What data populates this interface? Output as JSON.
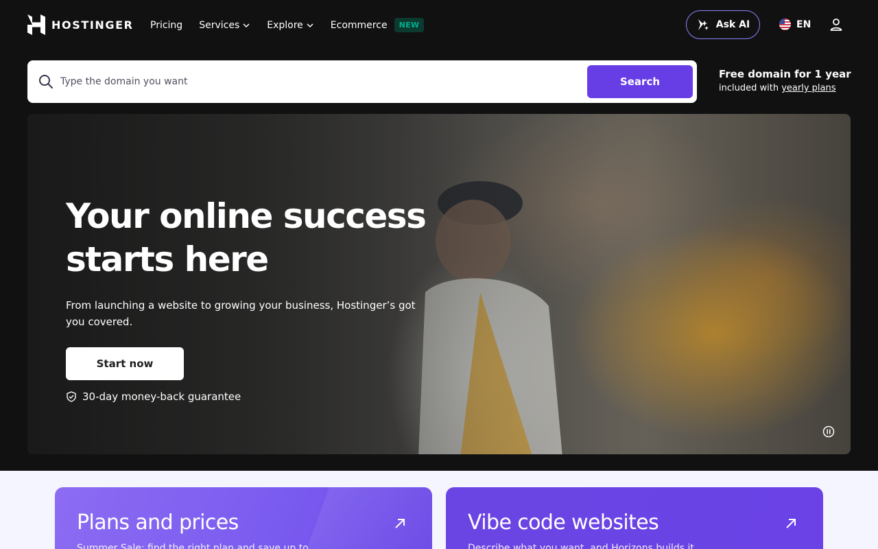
{
  "brand": {
    "name": "HOSTINGER"
  },
  "nav": {
    "items": [
      {
        "label": "Pricing",
        "has_dropdown": false
      },
      {
        "label": "Services",
        "has_dropdown": true
      },
      {
        "label": "Explore",
        "has_dropdown": true
      },
      {
        "label": "Ecommerce",
        "has_dropdown": false,
        "badge": "NEW"
      }
    ],
    "ask_ai_label": "Ask AI",
    "language": "EN",
    "icons": [
      "hostinger-logo-icon",
      "chevron-down-icon",
      "ai-sparkle-icon",
      "us-flag-icon",
      "user-icon"
    ]
  },
  "search": {
    "placeholder": "Type the domain you want",
    "value": "",
    "button_label": "Search"
  },
  "promo": {
    "title": "Free domain for 1 year",
    "subtitle_prefix": "included with ",
    "subtitle_link": "yearly plans"
  },
  "hero": {
    "title": "Your online success starts here",
    "subtitle": "From launching a website to growing your business, Hostinger’s got you covered.",
    "cta_label": "Start now",
    "guarantee": "30-day money-back guarantee"
  },
  "cards": [
    {
      "title": "Plans and prices",
      "description": "Summer Sale: find the right plan and save up to"
    },
    {
      "title": "Vibe code websites",
      "description": "Describe what you want, and Horizons builds it"
    }
  ],
  "colors": {
    "page_bg": "#111112",
    "accent": "#673de6",
    "badge_text": "#00b090",
    "badge_bg": "#0d3a2e",
    "lower_bg": "#f4f5ff"
  }
}
